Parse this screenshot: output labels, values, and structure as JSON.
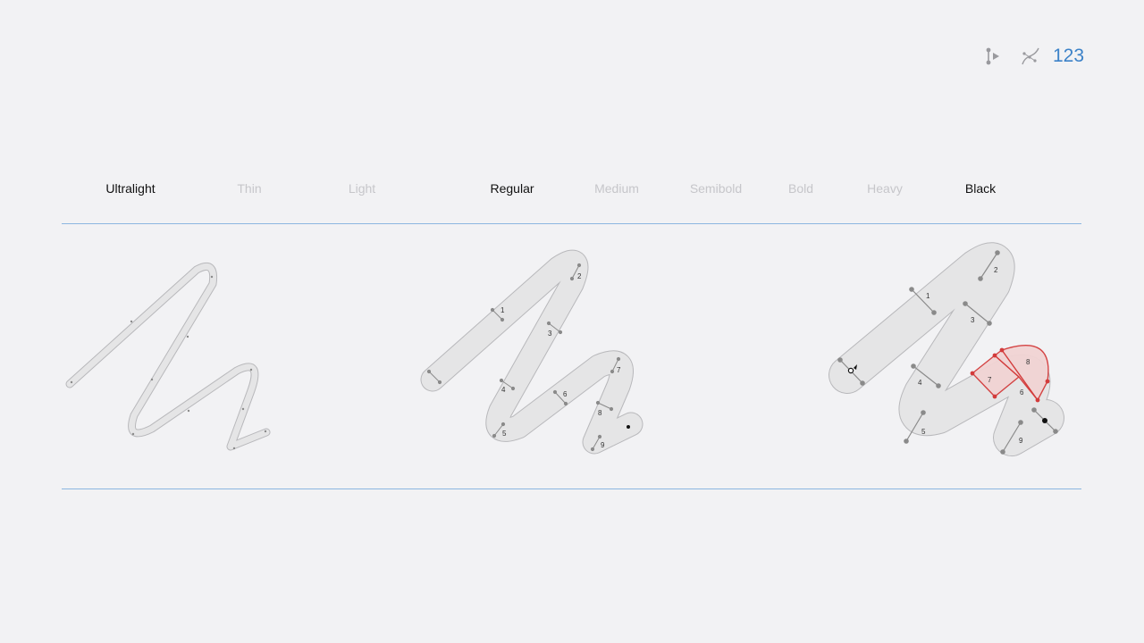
{
  "toolbar": {
    "items": [
      {
        "name": "point-play-icon"
      },
      {
        "name": "bezier-path-icon"
      }
    ],
    "numbers_label": "123",
    "accent_color": "#3c82c8"
  },
  "weights": [
    {
      "label": "Ultralight",
      "active": true
    },
    {
      "label": "Thin",
      "active": false
    },
    {
      "label": "Light",
      "active": false
    },
    {
      "label": "Regular",
      "active": true
    },
    {
      "label": "Medium",
      "active": false
    },
    {
      "label": "Semibold",
      "active": false
    },
    {
      "label": "Bold",
      "active": false
    },
    {
      "label": "Heavy",
      "active": false
    },
    {
      "label": "Black",
      "active": true
    }
  ],
  "glyphs": [
    {
      "name": "ultralight-glyph",
      "segment_labels": []
    },
    {
      "name": "regular-glyph",
      "segment_labels": [
        "1",
        "2",
        "3",
        "4",
        "5",
        "6",
        "7",
        "8",
        "9"
      ]
    },
    {
      "name": "black-glyph",
      "segment_labels": [
        "1",
        "2",
        "3",
        "4",
        "5",
        "6",
        "7",
        "8",
        "9"
      ],
      "highlighted_segments": [
        "7",
        "8"
      ]
    }
  ],
  "colors": {
    "stroke_fill": "#e5e5e6",
    "stroke_outline": "#b8b8bb",
    "handle": "#8a8a8a",
    "highlight": "#d33b3b",
    "rule": "#8cb6e0"
  }
}
